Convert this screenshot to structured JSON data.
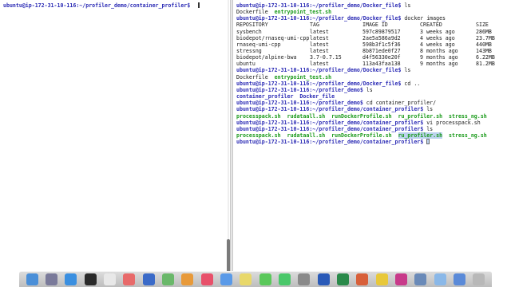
{
  "left_pane": {
    "prompt_host": "ubuntu@ip-172-31-10-116",
    "prompt_path": ":~/profiler_demo/container_profiler$ "
  },
  "right_pane": {
    "prompt_host": "ubuntu@ip-172-31-10-116",
    "path_docker_file": ":~/profiler_demo/Docker_file$ ",
    "path_demo": ":~/profiler_demo$ ",
    "path_container_profiler": ":~/profiler_demo/container_profiler$ ",
    "cmd_ls": "ls",
    "cmd_docker_images": "docker images",
    "cmd_cd_up": "cd ..",
    "cmd_cd_cp": "cd container_profiler/",
    "cmd_vi": "vi processpack.sh",
    "ls1": [
      "Dockerfile",
      "entrypoint_test.sh"
    ],
    "ls2": [
      "Dockerfile",
      "entrypoint_test.sh"
    ],
    "ls3": [
      "container_profiler",
      "Docker_file"
    ],
    "ls4": [
      "processpack.sh",
      "rudataall.sh",
      "runDockerProfile.sh",
      "ru_profiler.sh",
      "stress_ng.sh"
    ],
    "ls5": [
      "processpack.sh",
      "rudataall.sh",
      "runDockerProfile.sh",
      "ru_profiler.sh",
      "stress_ng.sh"
    ],
    "images_headers": [
      "REPOSITORY",
      "TAG",
      "IMAGE ID",
      "CREATED",
      "SIZE"
    ],
    "images_rows": [
      [
        "sysbench",
        "latest",
        "597c89879517",
        "3 weeks ago",
        "286MB"
      ],
      [
        "biodepot/rnaseq-umi-cpp",
        "latest",
        "2ae5a586a9d2",
        "4 weeks ago",
        "23.7MB"
      ],
      [
        "rnaseq-umi-cpp",
        "latest",
        "598b3f1c5f36",
        "4 weeks ago",
        "440MB"
      ],
      [
        "stressng",
        "latest",
        "8b871ede0f27",
        "8 months ago",
        "143MB"
      ],
      [
        "biodepot/alpine-bwa",
        "3.7-0.7.15",
        "d4f56330e20f",
        "9 months ago",
        "6.22MB"
      ],
      [
        "ubuntu",
        "latest",
        "113a43faa138",
        "9 months ago",
        "81.2MB"
      ]
    ]
  },
  "dock": {
    "icons": [
      "finder-icon",
      "launchpad-icon",
      "safari-icon",
      "terminal-icon",
      "calendar-icon",
      "photos-icon",
      "xcode-icon",
      "maps-icon",
      "books-icon",
      "music-icon",
      "app-icon",
      "notes-icon",
      "messages-icon",
      "facetime-icon",
      "system-prefs-icon",
      "word-icon",
      "excel-icon",
      "powerpoint-icon",
      "chrome-icon",
      "slack-icon",
      "preview-icon",
      "folder-icon",
      "downloads-icon",
      "trash-icon"
    ],
    "colors": [
      "#4a8fd8",
      "#7a7a9a",
      "#3a8fe0",
      "#2a2a2a",
      "#e8e8e8",
      "#e86a6a",
      "#3a6ac8",
      "#6ab86a",
      "#e89a3a",
      "#e8506a",
      "#5a9ae8",
      "#e8d86a",
      "#5ac85a",
      "#4ac86a",
      "#8a8a8a",
      "#2a5ab8",
      "#2a8a4a",
      "#d8603a",
      "#e8c83a",
      "#c83a8a",
      "#6a8ab8",
      "#8ab8e8",
      "#5a8ad8",
      "#b8b8b8"
    ]
  }
}
